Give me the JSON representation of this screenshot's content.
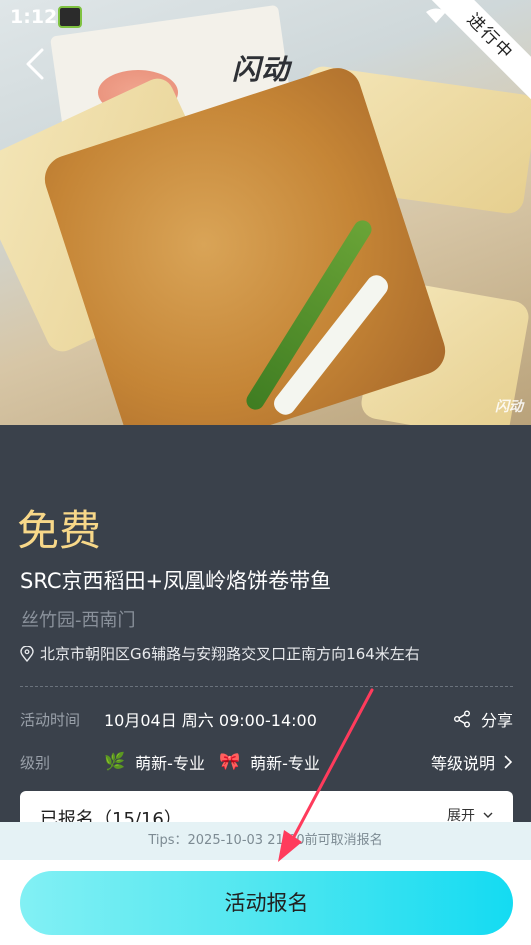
{
  "status_bar": {
    "time": "1:12"
  },
  "header": {
    "logo_text": "闪动",
    "ribbon_text": "进行中",
    "watermark": "闪动"
  },
  "event": {
    "price": "免费",
    "title": "SRC京西稻田+凤凰岭烙饼卷带鱼",
    "venue": "丝竹园-西南门",
    "address": "北京市朝阳区G6辅路与安翔路交叉口正南方向164米左右"
  },
  "details": {
    "time_label": "活动时间",
    "time_value": "10月04日 周六 09:00-14:00",
    "share_label": "分享",
    "level_label": "级别",
    "levels": [
      "萌新-专业",
      "萌新-专业"
    ],
    "level_help": "等级说明"
  },
  "registered": {
    "title": "已报名（15/16）",
    "expand_label": "展开"
  },
  "tips": "Tips：2025-10-03 21:00前可取消报名",
  "action": {
    "signup_label": "活动报名"
  },
  "colors": {
    "price": "#f8d889",
    "panel_bg": "#3a414b",
    "button_start": "#82f0f4",
    "button_end": "#14dbf2",
    "annotation_arrow": "#ff3b5c"
  }
}
